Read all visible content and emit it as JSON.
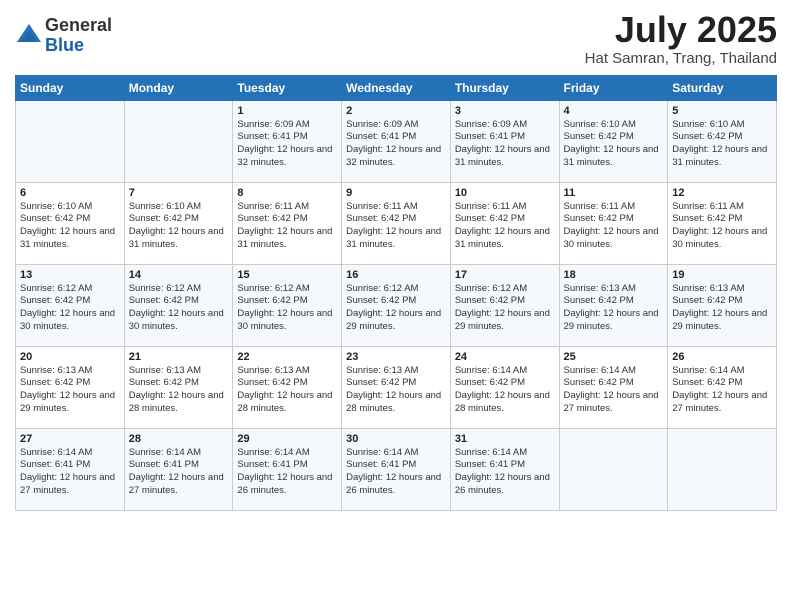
{
  "logo": {
    "general": "General",
    "blue": "Blue"
  },
  "title": {
    "month_year": "July 2025",
    "location": "Hat Samran, Trang, Thailand"
  },
  "weekdays": [
    "Sunday",
    "Monday",
    "Tuesday",
    "Wednesday",
    "Thursday",
    "Friday",
    "Saturday"
  ],
  "weeks": [
    [
      {
        "day": "",
        "sunrise": "",
        "sunset": "",
        "daylight": ""
      },
      {
        "day": "",
        "sunrise": "",
        "sunset": "",
        "daylight": ""
      },
      {
        "day": "1",
        "sunrise": "Sunrise: 6:09 AM",
        "sunset": "Sunset: 6:41 PM",
        "daylight": "Daylight: 12 hours and 32 minutes."
      },
      {
        "day": "2",
        "sunrise": "Sunrise: 6:09 AM",
        "sunset": "Sunset: 6:41 PM",
        "daylight": "Daylight: 12 hours and 32 minutes."
      },
      {
        "day": "3",
        "sunrise": "Sunrise: 6:09 AM",
        "sunset": "Sunset: 6:41 PM",
        "daylight": "Daylight: 12 hours and 31 minutes."
      },
      {
        "day": "4",
        "sunrise": "Sunrise: 6:10 AM",
        "sunset": "Sunset: 6:42 PM",
        "daylight": "Daylight: 12 hours and 31 minutes."
      },
      {
        "day": "5",
        "sunrise": "Sunrise: 6:10 AM",
        "sunset": "Sunset: 6:42 PM",
        "daylight": "Daylight: 12 hours and 31 minutes."
      }
    ],
    [
      {
        "day": "6",
        "sunrise": "Sunrise: 6:10 AM",
        "sunset": "Sunset: 6:42 PM",
        "daylight": "Daylight: 12 hours and 31 minutes."
      },
      {
        "day": "7",
        "sunrise": "Sunrise: 6:10 AM",
        "sunset": "Sunset: 6:42 PM",
        "daylight": "Daylight: 12 hours and 31 minutes."
      },
      {
        "day": "8",
        "sunrise": "Sunrise: 6:11 AM",
        "sunset": "Sunset: 6:42 PM",
        "daylight": "Daylight: 12 hours and 31 minutes."
      },
      {
        "day": "9",
        "sunrise": "Sunrise: 6:11 AM",
        "sunset": "Sunset: 6:42 PM",
        "daylight": "Daylight: 12 hours and 31 minutes."
      },
      {
        "day": "10",
        "sunrise": "Sunrise: 6:11 AM",
        "sunset": "Sunset: 6:42 PM",
        "daylight": "Daylight: 12 hours and 31 minutes."
      },
      {
        "day": "11",
        "sunrise": "Sunrise: 6:11 AM",
        "sunset": "Sunset: 6:42 PM",
        "daylight": "Daylight: 12 hours and 30 minutes."
      },
      {
        "day": "12",
        "sunrise": "Sunrise: 6:11 AM",
        "sunset": "Sunset: 6:42 PM",
        "daylight": "Daylight: 12 hours and 30 minutes."
      }
    ],
    [
      {
        "day": "13",
        "sunrise": "Sunrise: 6:12 AM",
        "sunset": "Sunset: 6:42 PM",
        "daylight": "Daylight: 12 hours and 30 minutes."
      },
      {
        "day": "14",
        "sunrise": "Sunrise: 6:12 AM",
        "sunset": "Sunset: 6:42 PM",
        "daylight": "Daylight: 12 hours and 30 minutes."
      },
      {
        "day": "15",
        "sunrise": "Sunrise: 6:12 AM",
        "sunset": "Sunset: 6:42 PM",
        "daylight": "Daylight: 12 hours and 30 minutes."
      },
      {
        "day": "16",
        "sunrise": "Sunrise: 6:12 AM",
        "sunset": "Sunset: 6:42 PM",
        "daylight": "Daylight: 12 hours and 29 minutes."
      },
      {
        "day": "17",
        "sunrise": "Sunrise: 6:12 AM",
        "sunset": "Sunset: 6:42 PM",
        "daylight": "Daylight: 12 hours and 29 minutes."
      },
      {
        "day": "18",
        "sunrise": "Sunrise: 6:13 AM",
        "sunset": "Sunset: 6:42 PM",
        "daylight": "Daylight: 12 hours and 29 minutes."
      },
      {
        "day": "19",
        "sunrise": "Sunrise: 6:13 AM",
        "sunset": "Sunset: 6:42 PM",
        "daylight": "Daylight: 12 hours and 29 minutes."
      }
    ],
    [
      {
        "day": "20",
        "sunrise": "Sunrise: 6:13 AM",
        "sunset": "Sunset: 6:42 PM",
        "daylight": "Daylight: 12 hours and 29 minutes."
      },
      {
        "day": "21",
        "sunrise": "Sunrise: 6:13 AM",
        "sunset": "Sunset: 6:42 PM",
        "daylight": "Daylight: 12 hours and 28 minutes."
      },
      {
        "day": "22",
        "sunrise": "Sunrise: 6:13 AM",
        "sunset": "Sunset: 6:42 PM",
        "daylight": "Daylight: 12 hours and 28 minutes."
      },
      {
        "day": "23",
        "sunrise": "Sunrise: 6:13 AM",
        "sunset": "Sunset: 6:42 PM",
        "daylight": "Daylight: 12 hours and 28 minutes."
      },
      {
        "day": "24",
        "sunrise": "Sunrise: 6:14 AM",
        "sunset": "Sunset: 6:42 PM",
        "daylight": "Daylight: 12 hours and 28 minutes."
      },
      {
        "day": "25",
        "sunrise": "Sunrise: 6:14 AM",
        "sunset": "Sunset: 6:42 PM",
        "daylight": "Daylight: 12 hours and 27 minutes."
      },
      {
        "day": "26",
        "sunrise": "Sunrise: 6:14 AM",
        "sunset": "Sunset: 6:42 PM",
        "daylight": "Daylight: 12 hours and 27 minutes."
      }
    ],
    [
      {
        "day": "27",
        "sunrise": "Sunrise: 6:14 AM",
        "sunset": "Sunset: 6:41 PM",
        "daylight": "Daylight: 12 hours and 27 minutes."
      },
      {
        "day": "28",
        "sunrise": "Sunrise: 6:14 AM",
        "sunset": "Sunset: 6:41 PM",
        "daylight": "Daylight: 12 hours and 27 minutes."
      },
      {
        "day": "29",
        "sunrise": "Sunrise: 6:14 AM",
        "sunset": "Sunset: 6:41 PM",
        "daylight": "Daylight: 12 hours and 26 minutes."
      },
      {
        "day": "30",
        "sunrise": "Sunrise: 6:14 AM",
        "sunset": "Sunset: 6:41 PM",
        "daylight": "Daylight: 12 hours and 26 minutes."
      },
      {
        "day": "31",
        "sunrise": "Sunrise: 6:14 AM",
        "sunset": "Sunset: 6:41 PM",
        "daylight": "Daylight: 12 hours and 26 minutes."
      },
      {
        "day": "",
        "sunrise": "",
        "sunset": "",
        "daylight": ""
      },
      {
        "day": "",
        "sunrise": "",
        "sunset": "",
        "daylight": ""
      }
    ]
  ]
}
